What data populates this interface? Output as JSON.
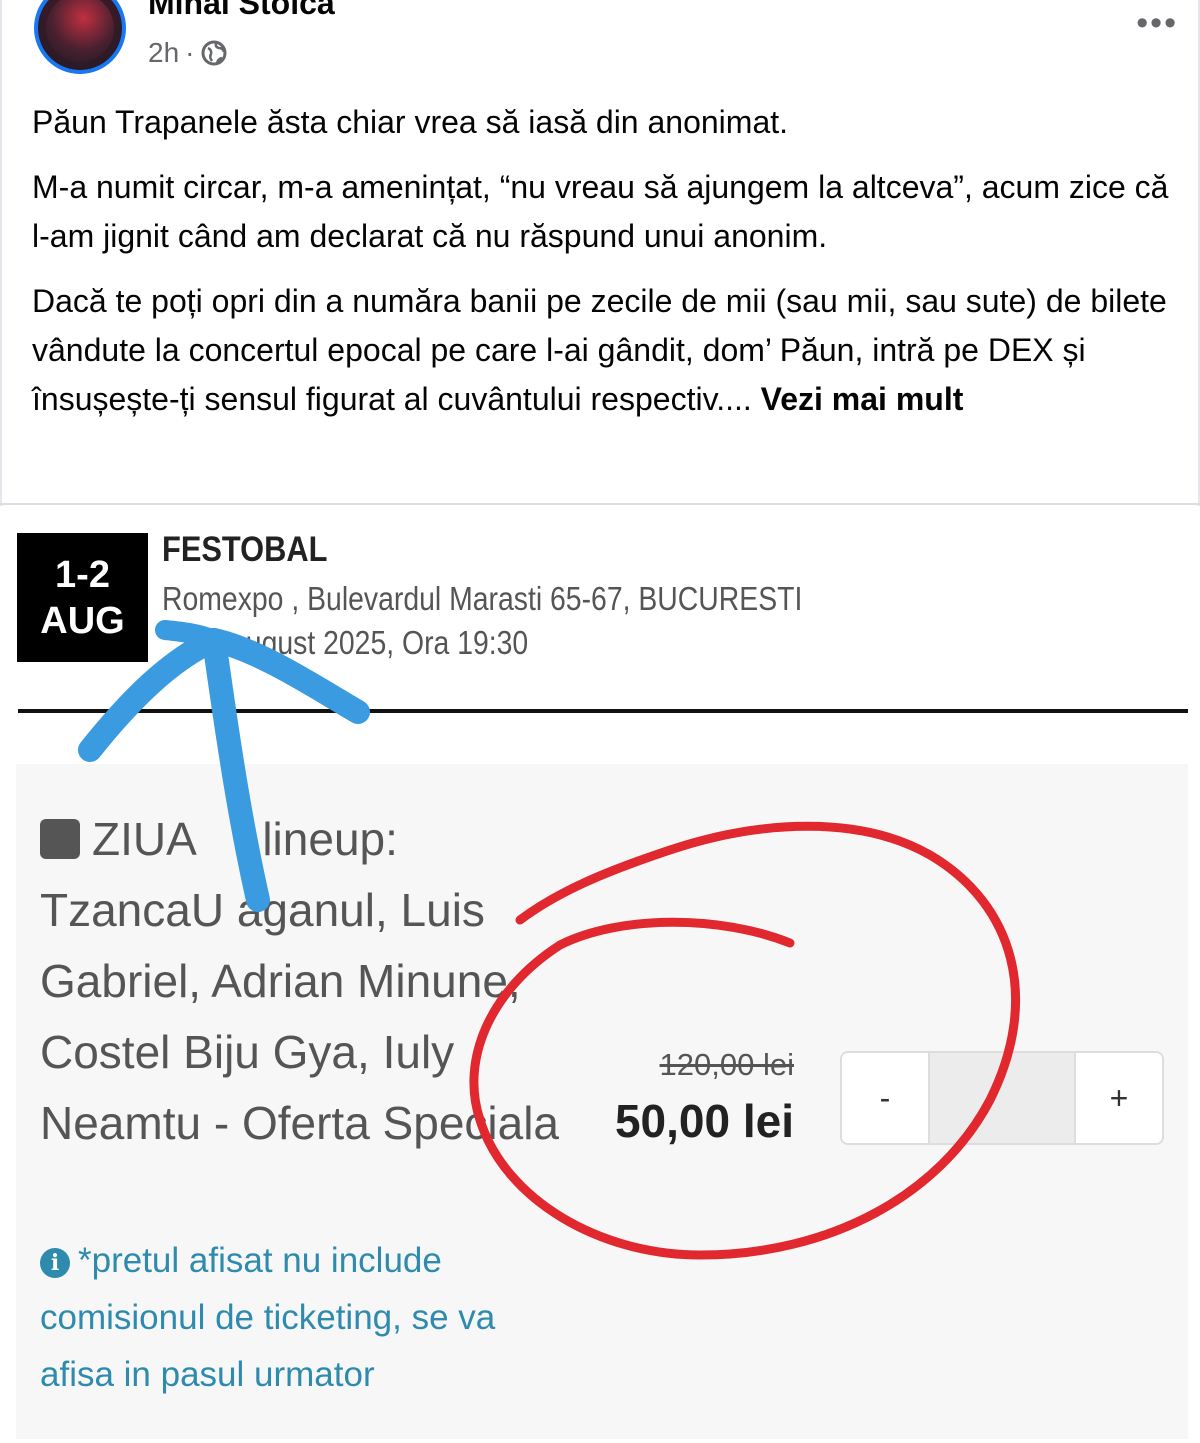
{
  "post": {
    "author": "Mihai Stoica",
    "time": "2h",
    "visibility_icon": "globe-icon",
    "more_icon": "more-options-icon",
    "paragraph_1": "Păun Trapanele ăsta chiar vrea să iasă din anonimat.",
    "paragraph_2": "M-a numit circar, m-a amenințat, “nu vreau să ajungem la altceva”, acum zice că l-am jignit când am declarat că nu răspund unui anonim.",
    "paragraph_3": "Dacă te poți opri din a număra banii pe zecile de mii (sau mii, sau sute) de bilete vândute la concertul epocal pe care l-ai gândit, dom’ Păun, intră pe DEX și însușește-ți sensul figurat al cuvântului respectiv....",
    "see_more": "Vezi mai mult"
  },
  "ticket": {
    "date_days": "1-2",
    "date_month": "AUG",
    "event_title": "FESTOBAL",
    "venue": "Romexpo , Bulevardul Marasti 65-67, BUCURESTI",
    "datetime_visible": "august 2025, Ora 19:30",
    "day_label": "ZIUA",
    "lineup_suffix": ", lineup:",
    "lineup_text": "TzancaU aganul, Luis Gabriel, Adrian Minune, Costel Biju Gya, Iuly Neamtu - Oferta Speciala",
    "note": "*pretul afisat nu include comisionul de ticketing, se va afisa in pasul urmator",
    "old_price": "120,00 lei",
    "new_price": "50,00 lei",
    "minus_label": "-",
    "plus_label": "+",
    "quantity": ""
  },
  "colors": {
    "arrow": "#3a9be0",
    "circle": "#e0282e",
    "info": "#2e8bad"
  }
}
